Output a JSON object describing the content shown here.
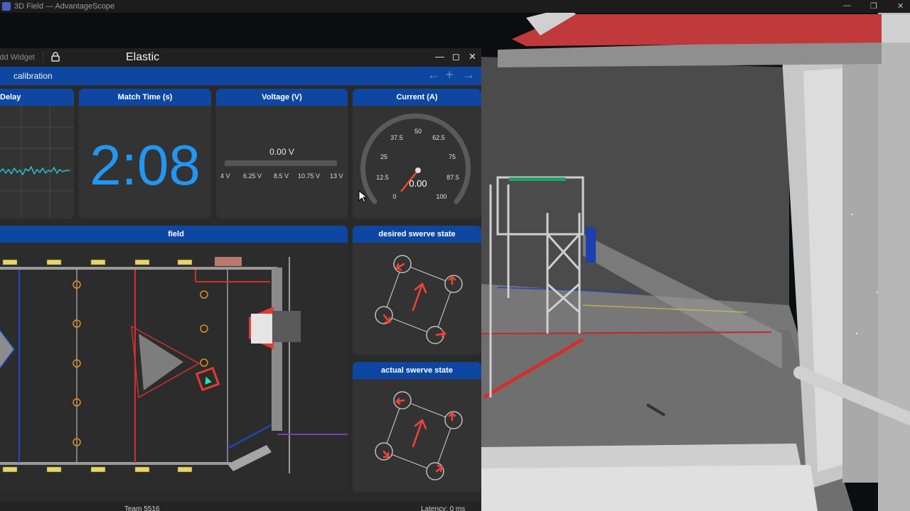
{
  "background_window": {
    "title": "3D Field — AdvantageScope",
    "controls": [
      "—",
      "❐",
      "✕"
    ]
  },
  "elastic": {
    "add_widget": "Add Widget",
    "title": "Elastic",
    "controls": {
      "minimize": "—",
      "maximize": "◻",
      "close": "✕"
    },
    "tab": "calibration",
    "tab_actions": {
      "prev": "←",
      "add": "+",
      "next": "→"
    }
  },
  "widgets": {
    "delay": {
      "title": "Delay"
    },
    "match_time": {
      "title": "Match Time (s)",
      "value": "2:08"
    },
    "voltage": {
      "title": "Voltage (V)",
      "value": "0.00 V",
      "ticks": [
        "4 V",
        "6.25 V",
        "8.5 V",
        "10.75 V",
        "13 V"
      ],
      "level": 0
    },
    "current": {
      "title": "Current (A)",
      "value": "0.00",
      "ticks": [
        "0",
        "12.5",
        "25",
        "37.5",
        "50",
        "62.5",
        "75",
        "87.5",
        "100"
      ],
      "accent": "#f44336"
    },
    "field": {
      "title": "field"
    },
    "desired_swerve": {
      "title": "desired swerve state"
    },
    "actual_swerve": {
      "title": "actual swerve state"
    }
  },
  "status": {
    "team": "Team 5516",
    "latency": "Latency: 0 ms"
  },
  "colors": {
    "header_blue": "#0e47a1",
    "match_time_blue": "#2196f3",
    "graph_line": "#26c6da",
    "alert_red": "#e53935"
  }
}
